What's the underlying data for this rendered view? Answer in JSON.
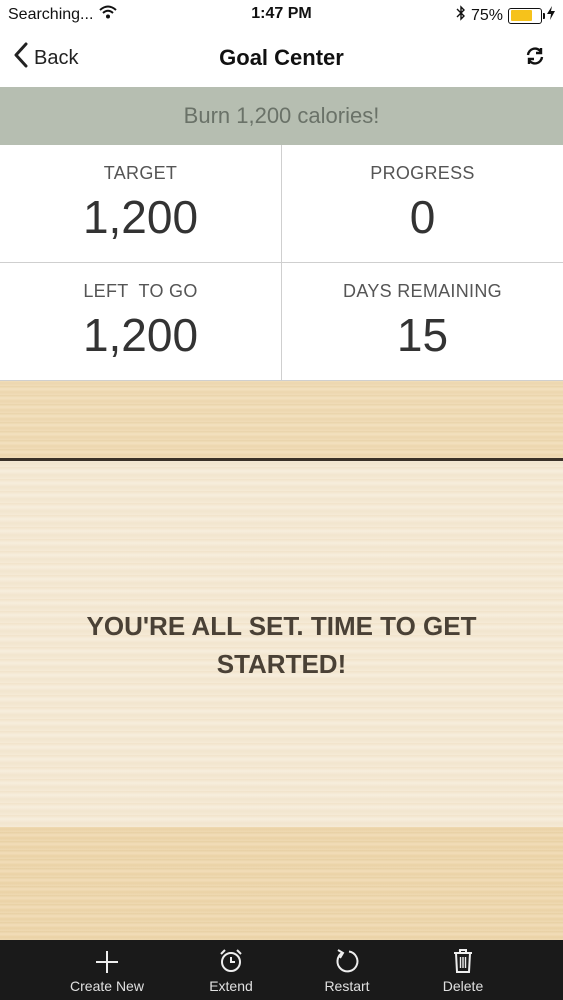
{
  "status_bar": {
    "carrier": "Searching...",
    "time": "1:47 PM",
    "battery_percent": "75%",
    "battery_level": 0.75,
    "battery_color": "#f6c21b"
  },
  "nav": {
    "back_label": "Back",
    "title": "Goal Center"
  },
  "goal": {
    "name": "Burn 1,200 calories!"
  },
  "stats": {
    "target_label": "TARGET",
    "target_value": "1,200",
    "progress_label": "PROGRESS",
    "progress_value": "0",
    "left_label": "LEFT  TO GO",
    "left_value": "1,200",
    "days_label": "DAYS REMAINING",
    "days_value": "15"
  },
  "message": "YOU'RE ALL SET. TIME TO GET STARTED!",
  "tabs": [
    {
      "label": "Create New",
      "icon": "plus-icon"
    },
    {
      "label": "Extend",
      "icon": "alarm-clock-icon"
    },
    {
      "label": "Restart",
      "icon": "restart-icon"
    },
    {
      "label": "Delete",
      "icon": "trash-icon"
    }
  ],
  "colors": {
    "banner_bg": "#b6beb1",
    "banner_text": "#6a7268",
    "tab_bar_bg": "#1a1a1a"
  }
}
